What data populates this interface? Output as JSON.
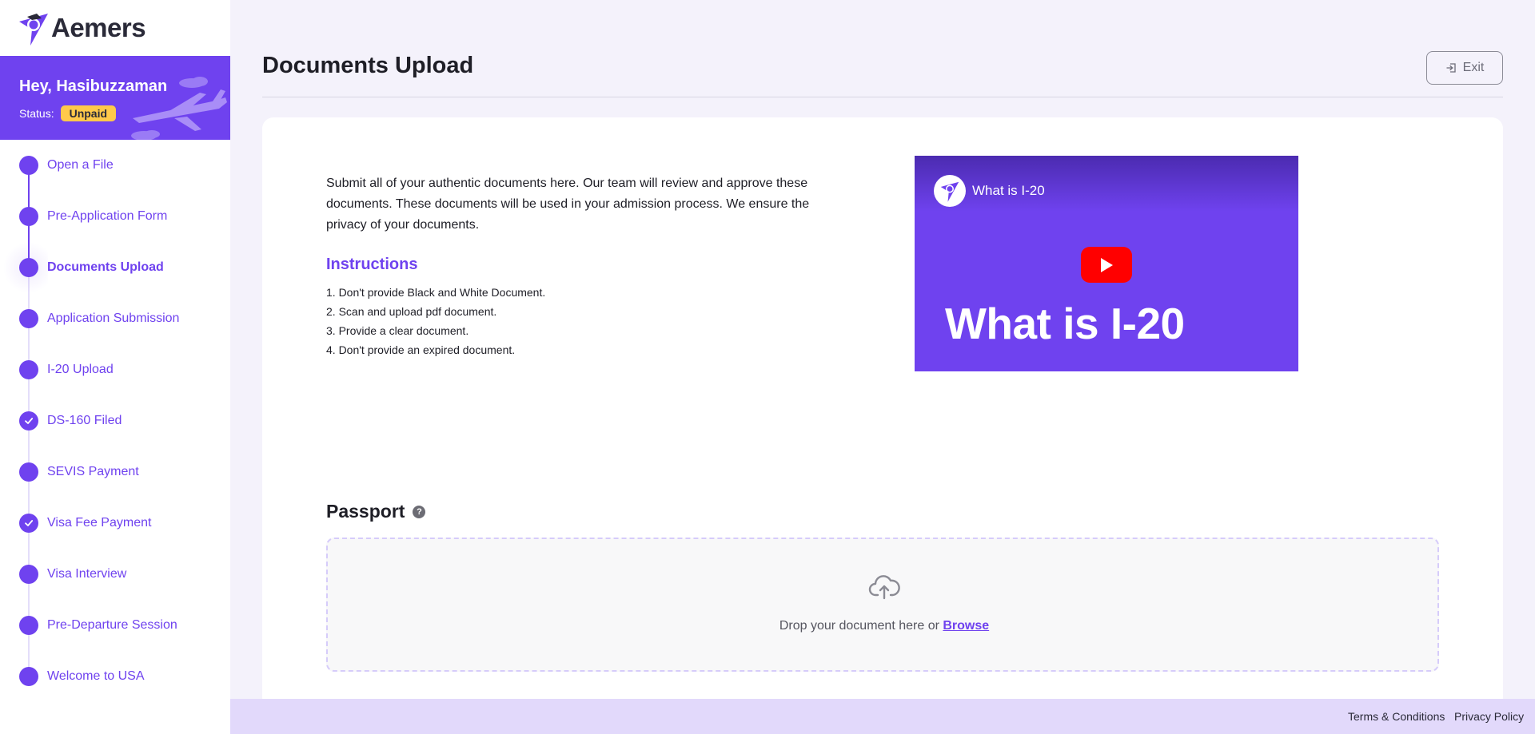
{
  "brand": {
    "name": "Aemers"
  },
  "user": {
    "greeting": "Hey, Hasibuzzaman",
    "status_label": "Status:",
    "status_value": "Unpaid"
  },
  "steps": [
    {
      "label": "Open a File",
      "icon": "step-dot",
      "state": "done"
    },
    {
      "label": "Pre-Application Form",
      "icon": "step-dot",
      "state": "done"
    },
    {
      "label": "Documents Upload",
      "icon": "step-dot",
      "state": "active"
    },
    {
      "label": "Application Submission",
      "icon": "step-dot",
      "state": "pending"
    },
    {
      "label": "I-20 Upload",
      "icon": "step-dot",
      "state": "pending"
    },
    {
      "label": "DS-160 Filed",
      "icon": "check-icon",
      "state": "checked"
    },
    {
      "label": "SEVIS Payment",
      "icon": "step-dot",
      "state": "pending"
    },
    {
      "label": "Visa Fee Payment",
      "icon": "check-icon",
      "state": "checked"
    },
    {
      "label": "Visa Interview",
      "icon": "step-dot",
      "state": "pending"
    },
    {
      "label": "Pre-Departure Session",
      "icon": "step-dot",
      "state": "pending"
    },
    {
      "label": "Welcome to USA",
      "icon": "step-dot",
      "state": "pending"
    }
  ],
  "page": {
    "title": "Documents Upload",
    "exit_label": "Exit"
  },
  "intro": "Submit all of your authentic documents here. Our team will review and approve these documents. These documents will be used in your admission process. We ensure the privacy of your documents.",
  "instructions": {
    "title": "Instructions",
    "items": [
      "1. Don't provide Black and White Document.",
      "2. Scan and upload pdf document.",
      "3. Provide a clear document.",
      "4. Don't provide an expired document."
    ]
  },
  "video": {
    "title": "What is I-20",
    "thumbnail_text": "What is I-20"
  },
  "passport": {
    "title": "Passport",
    "help_glyph": "?",
    "drop_text": "Drop your document here or",
    "browse_label": "Browse"
  },
  "footer": {
    "terms": "Terms & Conditions",
    "privacy": "Privacy Policy"
  },
  "colors": {
    "accent": "#6f42ef",
    "badge": "#ffc94a",
    "footer_bg": "#e2d9fb",
    "youtube_red": "#ff0000"
  }
}
